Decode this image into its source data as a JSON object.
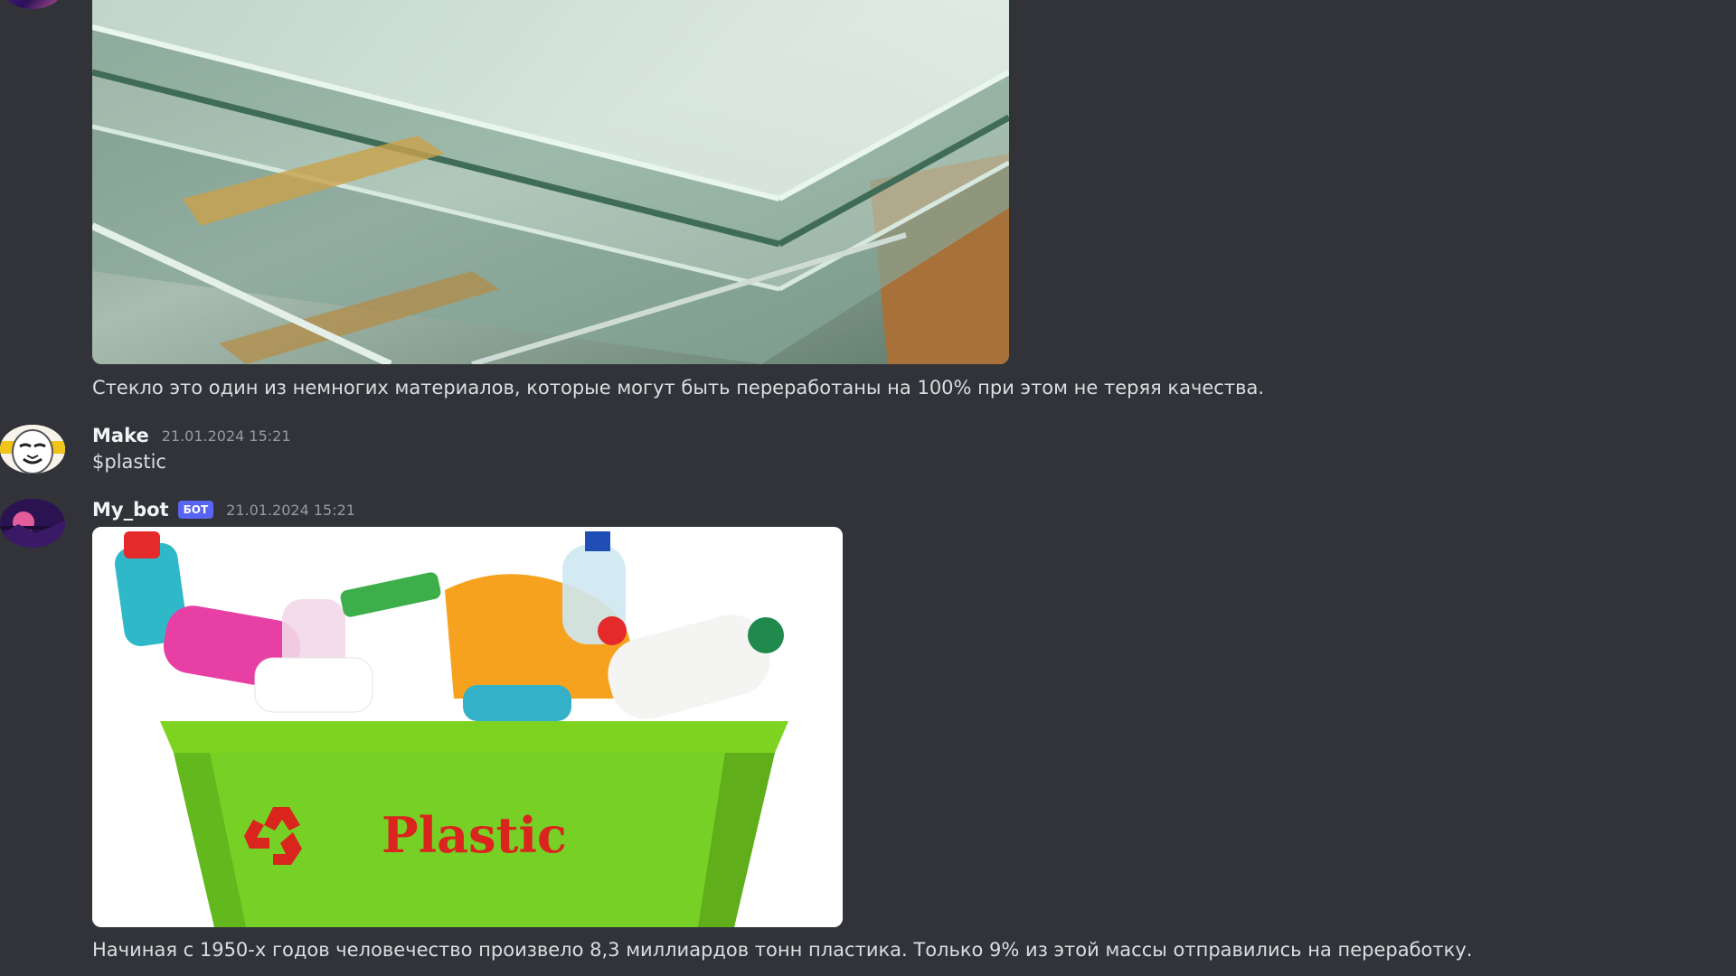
{
  "messages": [
    {
      "image": "glass-panes-photo",
      "text": "Стекло это один из немногих материалов, которые могут быть переработаны на 100% при этом не теряя качества."
    },
    {
      "author": "Make",
      "timestamp": "21.01.2024 15:21",
      "avatar": "anonymous-mask",
      "text": "$plastic"
    },
    {
      "author": "My_bot",
      "badge": "БОТ",
      "timestamp": "21.01.2024 15:21",
      "avatar": "purple-sunset",
      "image": "plastic-recycling-bin-photo",
      "image_label": "Plastic",
      "text": "Начиная с 1950-х годов человечество произвело 8,3 миллиардов тонн пластика. Только 9% из этой массы отправились на переработку."
    }
  ],
  "colors": {
    "background": "#313338",
    "text": "#dbdee1",
    "username": "#f2f3f5",
    "timestamp": "#949ba4",
    "bot_badge": "#5865f2"
  }
}
